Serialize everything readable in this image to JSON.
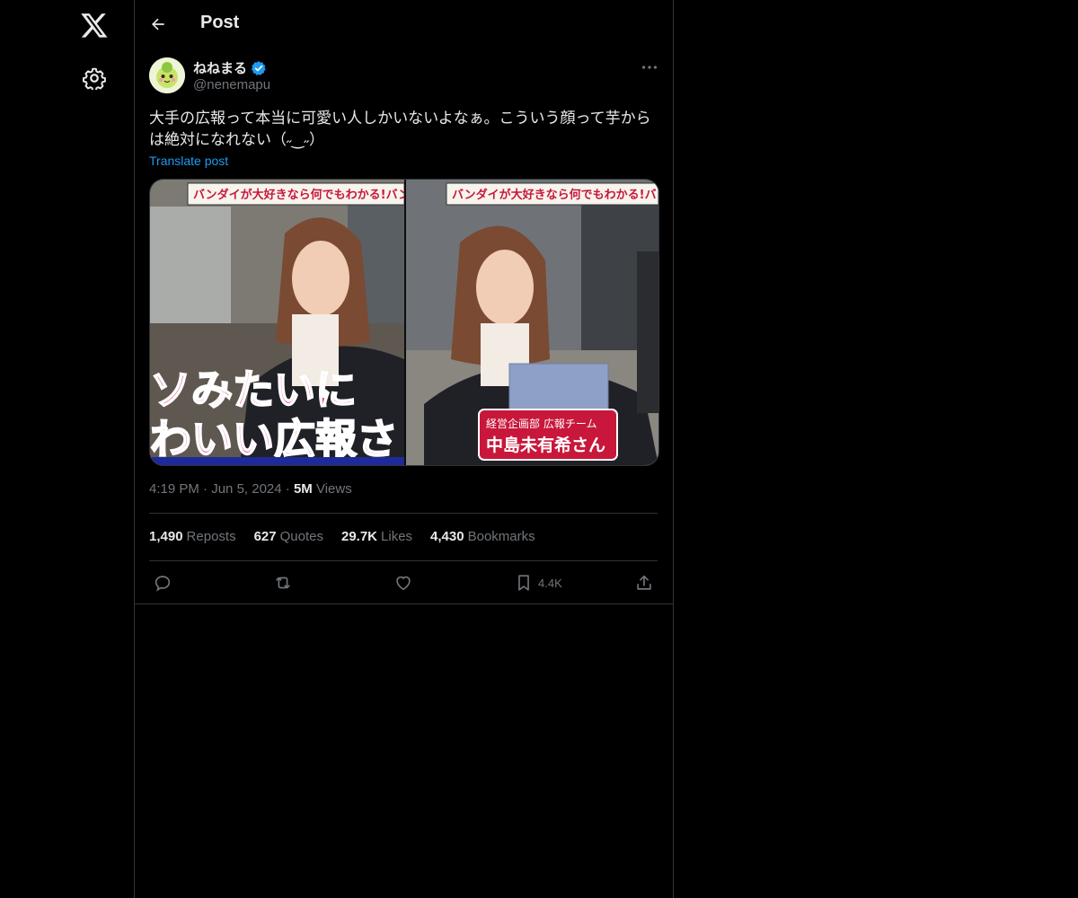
{
  "nav": {
    "logo_icon": "x-logo-icon",
    "settings_icon": "gear-icon"
  },
  "header": {
    "title": "Post"
  },
  "post": {
    "display_name": "ねねまる",
    "handle": "@nenemapu",
    "text": "大手の広報って本当に可愛い人しかいないよなぁ。こういう顔って芋からは絶対になれない（˶‿˶）",
    "translate_label": "Translate post",
    "media": {
      "left_banner": "バンダイが大好きなら何でもわかる!バンダ",
      "left_caption_line1": "ソみたいに",
      "left_caption_line2": "わいい広報さ",
      "right_banner": "バンダイが大好きなら何でもわかる!バンダ",
      "right_caption_line1": "経営企画部 広報チーム",
      "right_caption_line2": "中島未有希さん"
    },
    "time": "4:19 PM",
    "date": "Jun 5, 2024",
    "views_count": "5M",
    "views_label": "Views",
    "stats": {
      "reposts_count": "1,490",
      "reposts_label": "Reposts",
      "quotes_count": "627",
      "quotes_label": "Quotes",
      "likes_count": "29.7K",
      "likes_label": "Likes",
      "bookmarks_count": "4,430",
      "bookmarks_label": "Bookmarks"
    },
    "actions": {
      "bookmark_count": "4.4K"
    }
  },
  "colors": {
    "accent": "#1d9bf0",
    "background": "#000000",
    "muted": "#71767b",
    "border": "#2f3336"
  }
}
